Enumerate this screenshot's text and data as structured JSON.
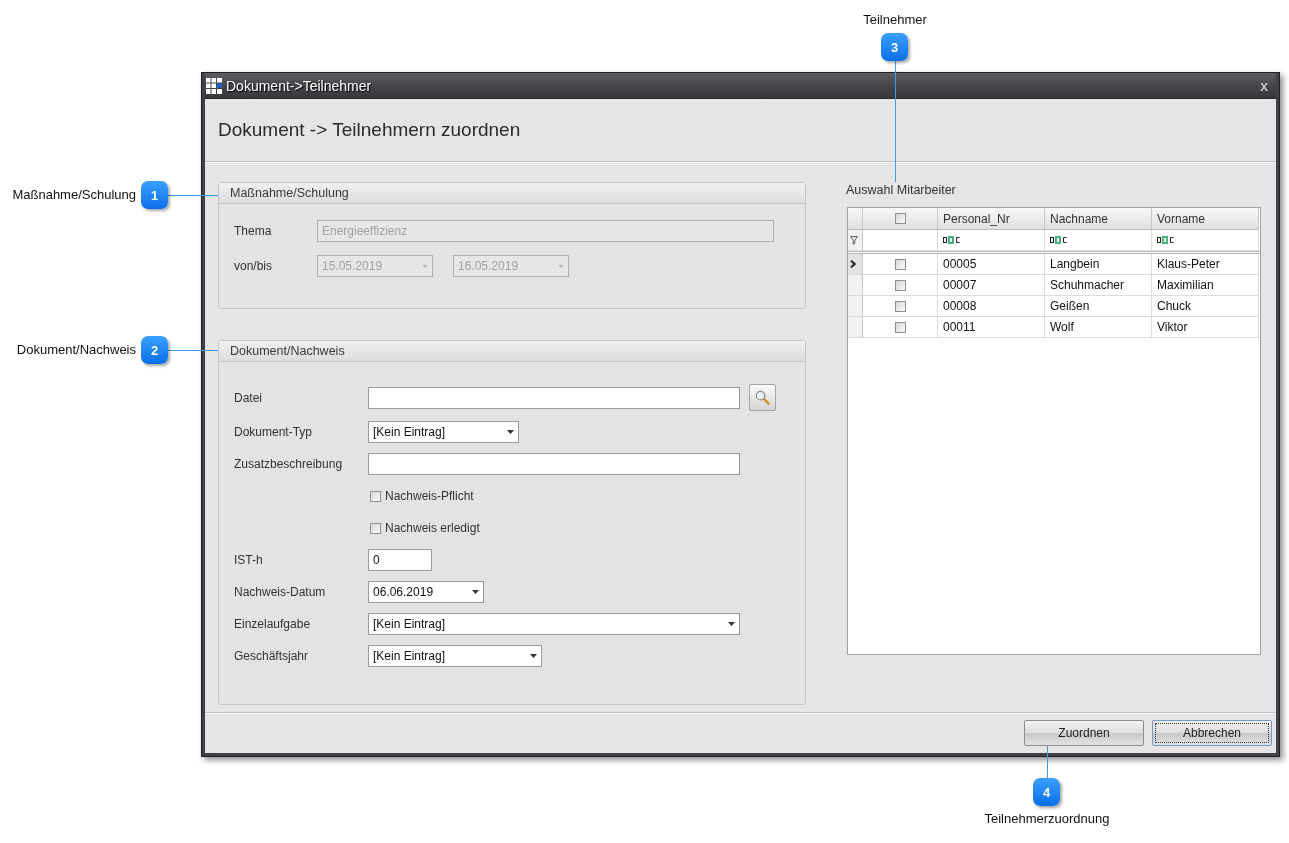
{
  "window": {
    "title": "Dokument->Teilnehmer",
    "close": "x"
  },
  "header": {
    "title": "Dokument -> Teilnehmern zuordnen"
  },
  "groups": [
    {
      "title": "Maßnahme/Schulung",
      "fields": [
        {
          "kind": "text",
          "label": "Thema",
          "value": "Energieeffizienz",
          "disabled": true
        },
        {
          "kind": "date_range",
          "label": "von/bis",
          "from": "15.05.2019",
          "to": "16.05.2019",
          "disabled": true
        }
      ]
    },
    {
      "title": "Dokument/Nachweis",
      "fields": [
        {
          "kind": "file",
          "label": "Datei",
          "disabled": false
        },
        {
          "kind": "dropdown",
          "label": "Dokument-Typ",
          "value": "[Kein Eintrag]",
          "disabled": false
        },
        {
          "kind": "text",
          "label": "Zusatzbeschreibung",
          "disabled": false
        },
        {
          "kind": "checkbox",
          "label": "Nachweis-Pflicht",
          "checked": false,
          "disabled": false
        },
        {
          "kind": "checkbox",
          "label": "Nachweis erledigt",
          "checked": false,
          "disabled": false
        },
        {
          "kind": "text",
          "label": "IST-h",
          "value": "0",
          "disabled": false
        },
        {
          "kind": "dropdown",
          "label": "Nachweis-Datum",
          "value": "06.06.2019",
          "disabled": false
        },
        {
          "kind": "dropdown",
          "label": "Einzelaufgabe",
          "value": "[Kein Eintrag]",
          "disabled": false
        },
        {
          "kind": "dropdown",
          "label": "Geschäftsjahr",
          "value": "[Kein Eintrag]",
          "disabled": false
        }
      ]
    }
  ],
  "employees": {
    "label": "Auswahl Mitarbeiter",
    "all_checked": false,
    "columns": [
      "Personal_Nr",
      "Nachname",
      "Vorname"
    ],
    "rows": [
      {
        "selected": true,
        "checked": false,
        "cells": [
          "00005",
          "Langbein",
          "Klaus-Peter"
        ]
      },
      {
        "selected": false,
        "checked": false,
        "cells": [
          "00007",
          "Schuhmacher",
          "Maximilian"
        ]
      },
      {
        "selected": false,
        "checked": false,
        "cells": [
          "00008",
          "Geißen",
          "Chuck"
        ]
      },
      {
        "selected": false,
        "checked": false,
        "cells": [
          "00011",
          "Wolf",
          "Viktor"
        ]
      }
    ]
  },
  "buttons": [
    {
      "label": "Zuordnen",
      "focused": false
    },
    {
      "label": "Abbrechen",
      "focused": true
    }
  ],
  "callouts": [
    {
      "number": "1",
      "label": "Maßnahme/Schulung"
    },
    {
      "number": "2",
      "label": "Dokument/Nachweis"
    },
    {
      "number": "3",
      "label": "Teilnehmer"
    },
    {
      "number": "4",
      "label": "Teilnehmerzuordnung"
    }
  ]
}
